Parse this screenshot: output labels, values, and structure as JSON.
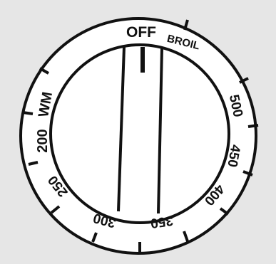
{
  "dial": {
    "labels": {
      "off": "OFF",
      "broil": "BROIL",
      "wm": "WM",
      "t200": "200",
      "t250": "250",
      "t300": "300",
      "t350": "350",
      "t400": "400",
      "t450": "450",
      "t500": "500"
    }
  },
  "colors": {
    "background": "#e6e6e6",
    "dial_face": "#ffffff",
    "ink": "#111111"
  }
}
